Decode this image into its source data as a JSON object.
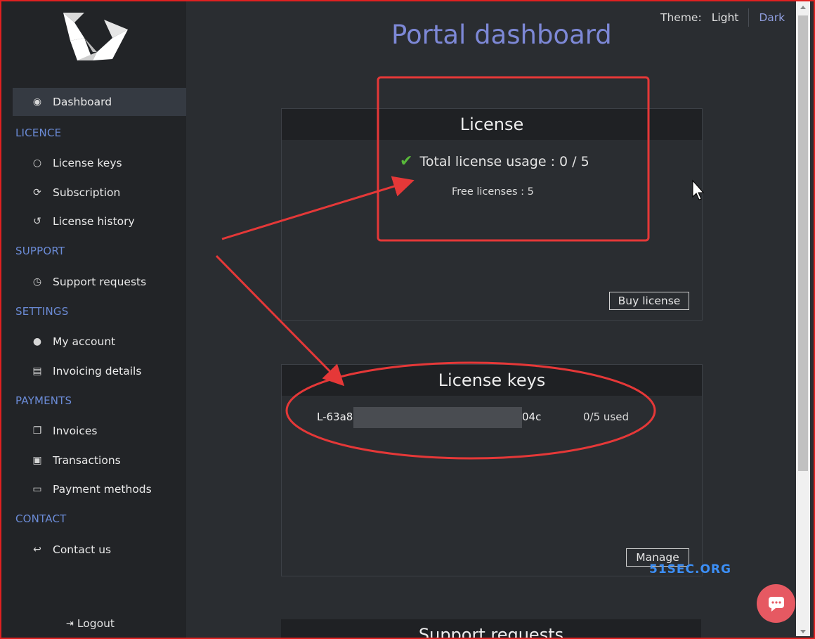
{
  "theme": {
    "label": "Theme:",
    "light": "Light",
    "dark": "Dark",
    "selected": "Dark"
  },
  "page_title": "Portal dashboard",
  "sidebar": {
    "dashboard": {
      "label": "Dashboard",
      "icon": "dashboard-gauge-icon"
    },
    "sections": [
      {
        "title": "LICENCE",
        "items": [
          {
            "label": "License keys",
            "icon": "circle-icon"
          },
          {
            "label": "Subscription",
            "icon": "refresh-icon"
          },
          {
            "label": "License history",
            "icon": "history-icon"
          }
        ]
      },
      {
        "title": "SUPPORT",
        "items": [
          {
            "label": "Support requests",
            "icon": "clock-icon"
          }
        ]
      },
      {
        "title": "SETTINGS",
        "items": [
          {
            "label": "My account",
            "icon": "user-icon"
          },
          {
            "label": "Invoicing details",
            "icon": "document-icon"
          }
        ]
      },
      {
        "title": "PAYMENTS",
        "items": [
          {
            "label": "Invoices",
            "icon": "copy-icon"
          },
          {
            "label": "Transactions",
            "icon": "money-icon"
          },
          {
            "label": "Payment methods",
            "icon": "credit-card-icon"
          }
        ]
      },
      {
        "title": "CONTACT",
        "items": [
          {
            "label": "Contact us",
            "icon": "reply-icon"
          }
        ]
      }
    ],
    "logout": "Logout"
  },
  "license_panel": {
    "title": "License",
    "usage_text": "Total license usage : 0 / 5",
    "free_text": "Free licenses : 5",
    "buy_button": "Buy license"
  },
  "keys_panel": {
    "title": "License keys",
    "key_prefix": "L-63a8",
    "key_suffix": "04c",
    "usage": "0/5 used",
    "manage_button": "Manage"
  },
  "support_panel": {
    "title": "Support requests"
  },
  "watermark": "51SEC.ORG",
  "colors": {
    "accent": "#7d88d6",
    "section": "#6b8bd6",
    "annotation": "#e53838",
    "check": "#58b83a",
    "chat": "#e65962"
  }
}
